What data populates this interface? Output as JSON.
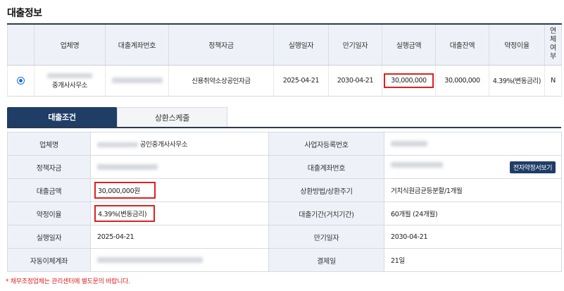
{
  "section_title": "대출정보",
  "loan_table": {
    "headers": [
      "업체명",
      "대출계좌번호",
      "정책자금",
      "실행일자",
      "만기일자",
      "실행금액",
      "대출잔액",
      "약정이율",
      "연체여부"
    ],
    "row": {
      "company_suffix": "중개사사무소",
      "policy_fund": "신용취약소상공인자금",
      "exec_date": "2025-04-21",
      "maturity_date": "2030-04-21",
      "exec_amount": "30,000,000",
      "balance": "30,000,000",
      "rate": "4.39%(변동금리)",
      "overdue": "N"
    }
  },
  "tabs": {
    "loan_terms": "대출조건",
    "repayment_schedule": "상환스케줄"
  },
  "detail": {
    "company_name_label": "업체명",
    "company_name_value": "공인중개사사무소",
    "biz_reg_no_label": "사업자등록번호",
    "policy_fund_label": "정책자금",
    "loan_account_label": "대출계좌번호",
    "contract_button": "전자약정서보기",
    "loan_amount_label": "대출금액",
    "loan_amount_value": "30,000,000원",
    "repayment_method_label": "상환방법/상환주기",
    "repayment_method_value": "거치식원금균등분할/1개월",
    "rate_label": "약정이율",
    "rate_value": "4.39%(변동금리)",
    "loan_period_label": "대출기간(거치기간)",
    "loan_period_value": "60개월 (24개월)",
    "exec_date_label": "실행일자",
    "exec_date_value": "2025-04-21",
    "maturity_label": "만기일자",
    "maturity_value": "2030-04-21",
    "auto_transfer_label": "자동이체계좌",
    "payment_day_label": "결제일",
    "payment_day_value": "21일"
  },
  "footnote": "* 채무조정업체는 관리센터에 별도문의 바랍니다.",
  "colors": {
    "accent": "#1f3d66",
    "highlight": "#e02020",
    "header_bg": "#eef2f8"
  }
}
